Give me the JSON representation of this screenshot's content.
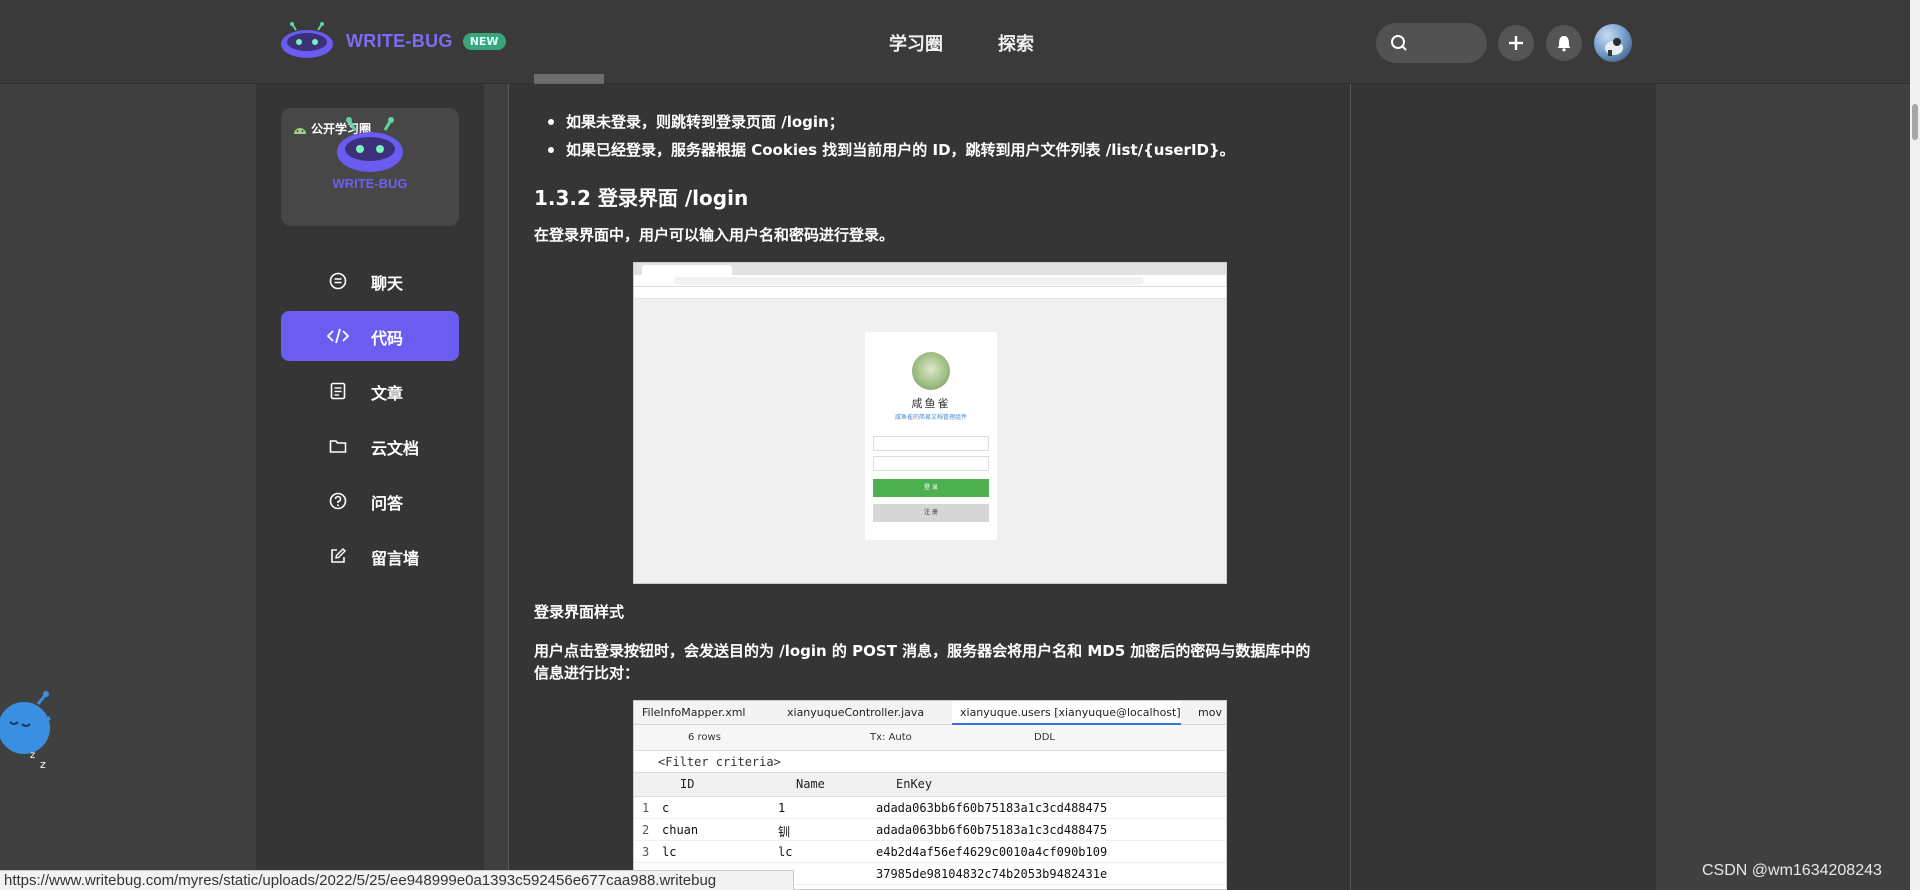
{
  "header": {
    "logo_text": "WRITE-BUG",
    "new_badge": "NEW",
    "nav": [
      "学习圈",
      "探索"
    ],
    "icons": [
      "search-icon",
      "plus-icon",
      "bell-icon",
      "avatar"
    ]
  },
  "sidebar": {
    "group_tag": "公开学习圈",
    "group_name": "WRITE-BUG",
    "items": [
      {
        "label": "聊天",
        "icon": "chat-icon",
        "active": false
      },
      {
        "label": "代码",
        "icon": "code-icon",
        "active": true
      },
      {
        "label": "文章",
        "icon": "document-icon",
        "active": false
      },
      {
        "label": "云文档",
        "icon": "folder-icon",
        "active": false
      },
      {
        "label": "问答",
        "icon": "question-icon",
        "active": false
      },
      {
        "label": "留言墙",
        "icon": "edit-icon",
        "active": false
      }
    ]
  },
  "article": {
    "bullets": [
      "如果未登录，则跳转到登录页面 /login；",
      "如果已经登录，服务器根据 Cookies 找到当前用户的 ID，跳转到用户文件列表 /list/{userID}。"
    ],
    "heading": "1.3.2 登录界面 /login",
    "intro": "在登录界面中，用户可以输入用户名和密码进行登录。",
    "caption": "登录界面样式",
    "para2_line1": "用户点击登录按钮时，会发送目的为 /login 的 POST 消息，服务器会将用户名和 MD5 加密后的密码与数据库中的",
    "para2_line2": "信息进行比对："
  },
  "login_shot": {
    "title": "咸鱼雀",
    "subtitle": "咸鱼雀的简易文档管理组件",
    "login_button": "登 录",
    "register_button": "注 册"
  },
  "db_shot": {
    "tabs": [
      "FileInfoMapper.xml",
      "xianyuqueController.java",
      "xianyuque.users [xianyuque@localhost]",
      "mov"
    ],
    "rows_label": "6 rows",
    "tx_label": "Tx: Auto",
    "ddl_label": "DDL",
    "filter": "<Filter criteria>",
    "columns": [
      "ID",
      "Name",
      "EnKey"
    ],
    "rows": [
      {
        "num": "1",
        "id": "c",
        "name": "1",
        "enkey": "adada063bb6f60b75183a1c3cd488475"
      },
      {
        "num": "2",
        "id": "chuan",
        "name": "钏",
        "enkey": "adada063bb6f60b75183a1c3cd488475"
      },
      {
        "num": "3",
        "id": "lc",
        "name": "lc",
        "enkey": "e4b2d4af56ef4629c0010a4cf090b109"
      },
      {
        "num": "",
        "id": "",
        "name": "",
        "enkey": "37985de98104832c74b2053b9482431e"
      }
    ]
  },
  "status_url": "https://www.writebug.com/myres/static/uploads/2022/5/25/ee948999e0a1393c592456e677caa988.writebug",
  "watermark": "CSDN @wm1634208243",
  "colors": {
    "accent": "#6c5cf0",
    "background": "#404040",
    "panel": "#353535"
  }
}
